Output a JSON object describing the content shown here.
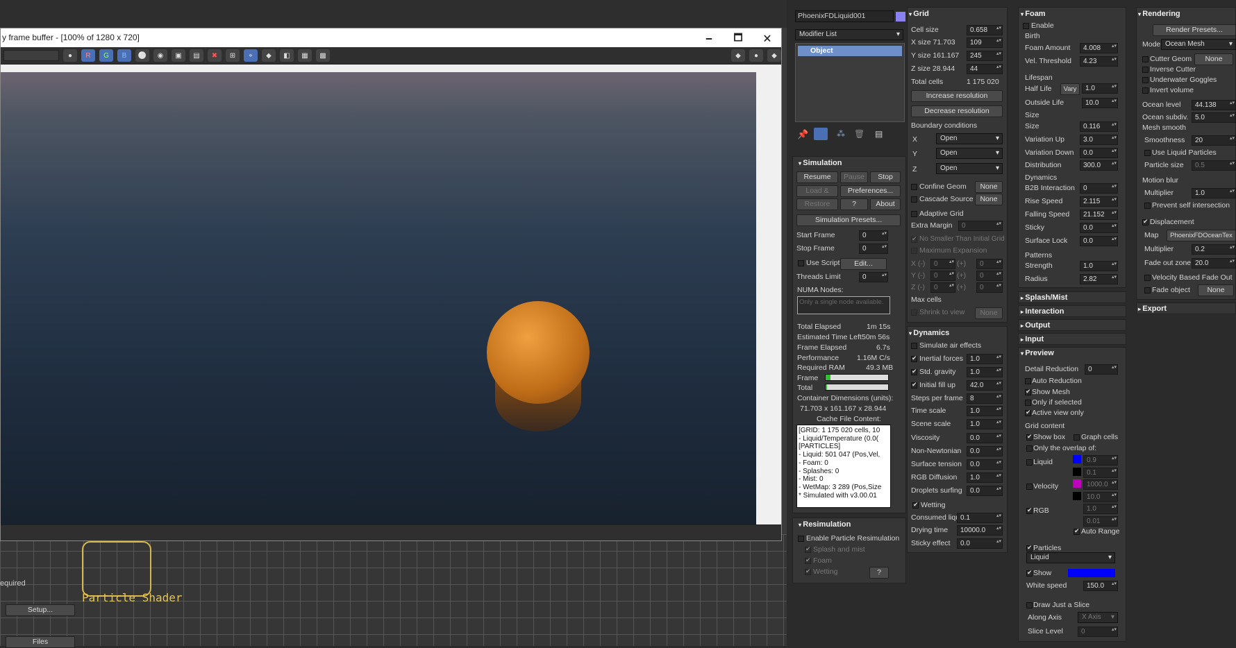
{
  "framebuffer": {
    "title": "y frame buffer - [100% of 1280 x 720]",
    "minimize": "🗕",
    "maximize": "🗖",
    "close": "🗙",
    "channel_r": "R",
    "channel_g": "G",
    "channel_b": "B"
  },
  "viewport": {
    "shader_label": "Particle Shader",
    "required_text": "equired",
    "setup_btn": "Setup...",
    "files_btn": "Files"
  },
  "modifier": {
    "object_name": "PhoenixFDLiquid001",
    "modifier_list": "Modifier List",
    "stack_item": "Object"
  },
  "simulation": {
    "header": "Simulation",
    "resume": "Resume",
    "pause": "Pause",
    "stop": "Stop",
    "load_start": "Load & Start",
    "preferences": "Preferences...",
    "restore": "Restore",
    "help": "?",
    "about": "About",
    "presets": "Simulation Presets...",
    "start_frame_label": "Start Frame",
    "start_frame": "0",
    "stop_frame_label": "Stop Frame",
    "stop_frame": "0",
    "use_script": "Use Script",
    "edit": "Edit...",
    "threads_label": "Threads Limit",
    "threads": "0",
    "numa_label": "NUMA Nodes:",
    "numa_placeholder": "Only a single node available.",
    "total_elapsed_label": "Total Elapsed",
    "total_elapsed": "1m 15s",
    "est_left_label": "Estimated Time Left",
    "est_left": "50m 56s",
    "frame_elapsed_label": "Frame Elapsed",
    "frame_elapsed": "6.7s",
    "performance_label": "Performance",
    "performance": "1.16M C/s",
    "ram_label": "Required RAM",
    "ram": "49.3 MB",
    "frame_label": "Frame",
    "frame_progress": 0.08,
    "total_label": "Total",
    "total_progress": 0.02,
    "container_label": "Container Dimensions (units):",
    "container": "71.703 x 161.167 x 28.944",
    "cache_label": "Cache File Content:",
    "cache_lines": [
      "[GRID: 1 175 020 cells, 10",
      "- Liquid/Temperature (0.0(",
      "[PARTICLES]",
      "- Liquid: 501 047 (Pos,Vel,",
      "- Foam: 0",
      "- Splashes: 0",
      "- Mist: 0",
      "- WetMap: 3 289 (Pos,Size",
      "* Simulated with v3.00.01"
    ]
  },
  "resim": {
    "header": "Resimulation",
    "enable": "Enable Particle Resimulation",
    "splash": "Splash and mist",
    "foam": "Foam",
    "wetting": "Wetting",
    "help": "?"
  },
  "grid": {
    "header": "Grid",
    "cell_size_label": "Cell size",
    "cell_size": "0.658",
    "x_label": "X size  71.703",
    "x": "109",
    "y_label": "Y size  161.167",
    "y": "245",
    "z_label": "Z size  28.944",
    "z": "44",
    "total_label": "Total cells",
    "total": "1 175 020",
    "increase": "Increase resolution",
    "decrease": "Decrease resolution",
    "boundary": "Boundary conditions",
    "bx": "X",
    "by": "Y",
    "bz": "Z",
    "open": "Open",
    "confine": "Confine Geom",
    "cascade": "Cascade Source",
    "none": "None",
    "adaptive": "Adaptive Grid",
    "extra_margin": "Extra Margin",
    "extra_margin_val": "0",
    "no_smaller": "No Smaller Than Initial Grid",
    "max_exp": "Maximum Expansion",
    "xm": "X (-)",
    "ym": "Y (-)",
    "zm": "Z (-)",
    "plus": "(+)",
    "zero": "0",
    "max_cells": "Max cells",
    "shrink": "Shrink to view"
  },
  "dynamics": {
    "header": "Dynamics",
    "air": "Simulate air effects",
    "inertial": "Inertial forces",
    "inertial_v": "1.0",
    "gravity": "Std. gravity",
    "gravity_v": "1.0",
    "fill": "Initial fill up",
    "fill_v": "42.0",
    "steps": "Steps per frame",
    "steps_v": "8",
    "time": "Time scale",
    "time_v": "1.0",
    "scene": "Scene scale",
    "scene_v": "1.0",
    "visc": "Viscosity",
    "visc_v": "0.0",
    "nonnewt": "Non-Newtonian",
    "nonnewt_v": "0.0",
    "surf": "Surface tension",
    "surf_v": "0.0",
    "rgb": "RGB Diffusion",
    "rgb_v": "1.0",
    "drop": "Droplets surfing",
    "drop_v": "0.0",
    "wetting": "Wetting",
    "consumed": "Consumed liquid",
    "consumed_v": "0.1",
    "drying": "Drying time",
    "drying_v": "10000.0",
    "sticky": "Sticky effect",
    "sticky_v": "0.0"
  },
  "foam": {
    "header": "Foam",
    "enable": "Enable",
    "birth": "Birth",
    "amount": "Foam Amount",
    "amount_v": "4.008",
    "vel": "Vel. Threshold",
    "vel_v": "4.23",
    "lifespan": "Lifespan",
    "half": "Half Life",
    "vary": "Vary",
    "half_v": "1.0",
    "outside": "Outside Life",
    "outside_v": "10.0",
    "size_h": "Size",
    "size": "Size",
    "size_v": "0.116",
    "varup": "Variation Up",
    "varup_v": "3.0",
    "vardown": "Variation Down",
    "vardown_v": "0.0",
    "dist": "Distribution",
    "dist_v": "300.0",
    "dyn": "Dynamics",
    "b2b": "B2B Interaction",
    "b2b_v": "0",
    "rise": "Rise Speed",
    "rise_v": "2.115",
    "fall": "Falling Speed",
    "fall_v": "21.152",
    "stick": "Sticky",
    "stick_v": "0.0",
    "lock": "Surface Lock",
    "lock_v": "0.0",
    "patterns": "Patterns",
    "strength": "Strength",
    "strength_v": "1.0",
    "radius": "Radius",
    "radius_v": "2.82"
  },
  "collapsed": {
    "splash": "Splash/Mist",
    "interaction": "Interaction",
    "output": "Output",
    "input": "Input"
  },
  "preview": {
    "header": "Preview",
    "detail": "Detail Reduction",
    "detail_v": "0",
    "auto": "Auto Reduction",
    "mesh": "Show Mesh",
    "only_sel": "Only if selected",
    "active": "Active view only",
    "grid_content": "Grid content",
    "show_box": "Show box",
    "graph": "Graph cells",
    "overlap": "Only the overlap of:",
    "liquid": "Liquid",
    "liq_hi": "0.9",
    "liq_lo": "0.1",
    "velocity": "Velocity",
    "vel_hi": "1000.0",
    "vel_lo": "10.0",
    "rgb": "RGB",
    "rgb_hi": "1.0",
    "rgb_lo": "0.01",
    "auto_range": "Auto Range",
    "particles": "Particles",
    "ptype": "Liquid",
    "show": "Show",
    "white": "White speed",
    "white_v": "150.0",
    "slice": "Draw Just a Slice",
    "along": "Along Axis",
    "axis": "X Axis",
    "level": "Slice Level",
    "level_v": "0",
    "colors": {
      "liquid": "#0000ff",
      "velocity": "#c000c0",
      "particle": "#0000ff"
    }
  },
  "rendering": {
    "header": "Rendering",
    "presets": "Render Presets...",
    "mode": "Mode",
    "mode_v": "Ocean Mesh",
    "cutter": "Cutter Geom",
    "none": "None",
    "inverse": "Inverse Cutter",
    "goggles": "Underwater Goggles",
    "invert": "Invert volume",
    "level": "Ocean level",
    "level_v": "44.138",
    "subdiv": "Ocean subdiv.",
    "subdiv_v": "5.0",
    "smooth_h": "Mesh smooth",
    "smooth": "Smoothness",
    "smooth_v": "20",
    "use_liq": "Use Liquid Particles",
    "psize": "Particle size",
    "psize_v": "0.5",
    "blur": "Motion blur",
    "mult": "Multiplier",
    "mult_v": "1.0",
    "self": "Prevent self intersection",
    "disp": "Displacement",
    "map": "Map",
    "map_v": "PhoenixFDOceanTex",
    "dmult": "Multiplier",
    "dmult_v": "0.2",
    "fade": "Fade out zone",
    "fade_v": "20.0",
    "vfade": "Velocity Based Fade Out",
    "fadeobj": "Fade object",
    "fadeobj_v": "None",
    "export": "Export"
  }
}
